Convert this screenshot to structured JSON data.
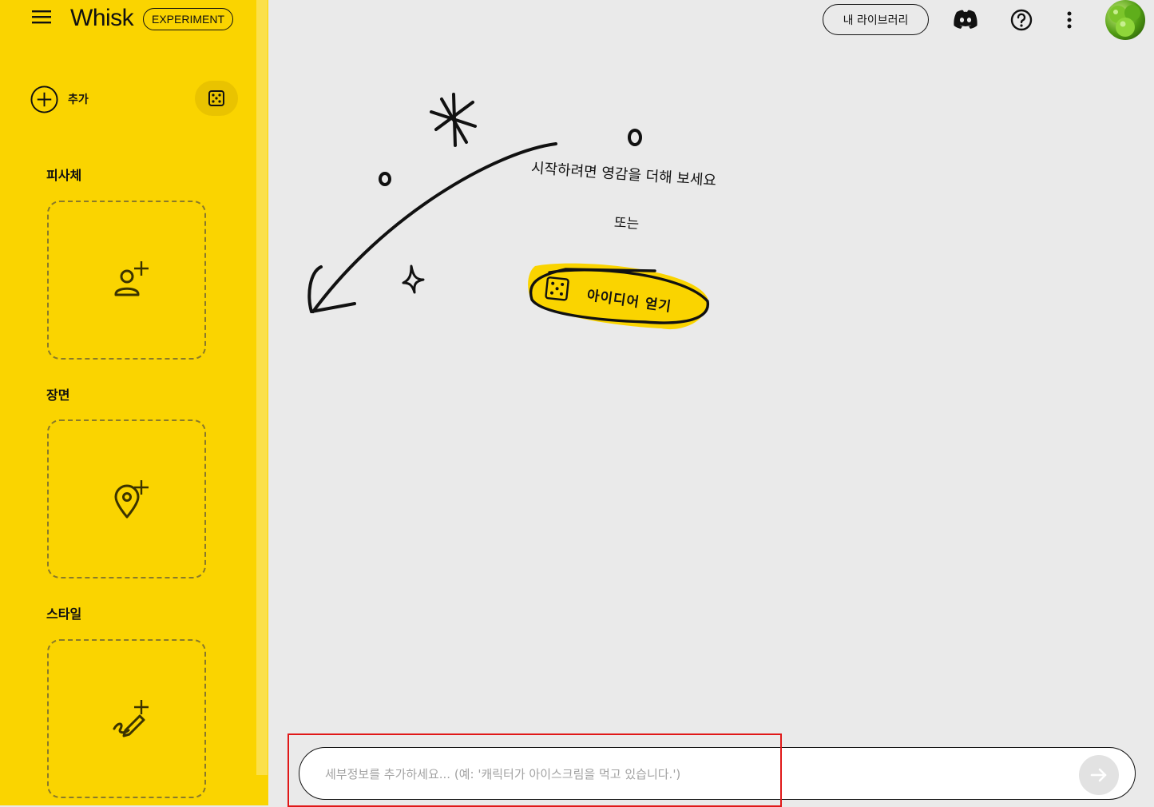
{
  "app": {
    "brand": "Whisk",
    "badge": "EXPERIMENT"
  },
  "sidebar": {
    "add_label": "추가",
    "sections": [
      {
        "title": "피사체",
        "icon": "person-add-icon"
      },
      {
        "title": "장면",
        "icon": "location-pin-icon"
      },
      {
        "title": "스타일",
        "icon": "brush-icon"
      }
    ]
  },
  "topbar": {
    "library_label": "내 라이브러리",
    "icons": [
      "discord-icon",
      "help-icon",
      "more-vert-icon",
      "avatar"
    ]
  },
  "main": {
    "hint": "시작하려면 영감을 더해 보세요",
    "or": "또는",
    "idea_button": "아이디어 얻기"
  },
  "prompt": {
    "placeholder": "세부정보를 추가하세요... (예: '캐릭터가 아이스크림을 먹고 있습니다.')"
  },
  "colors": {
    "sidebar": "#fad400",
    "canvas": "#eaeaea",
    "highlight": "#e01818"
  }
}
